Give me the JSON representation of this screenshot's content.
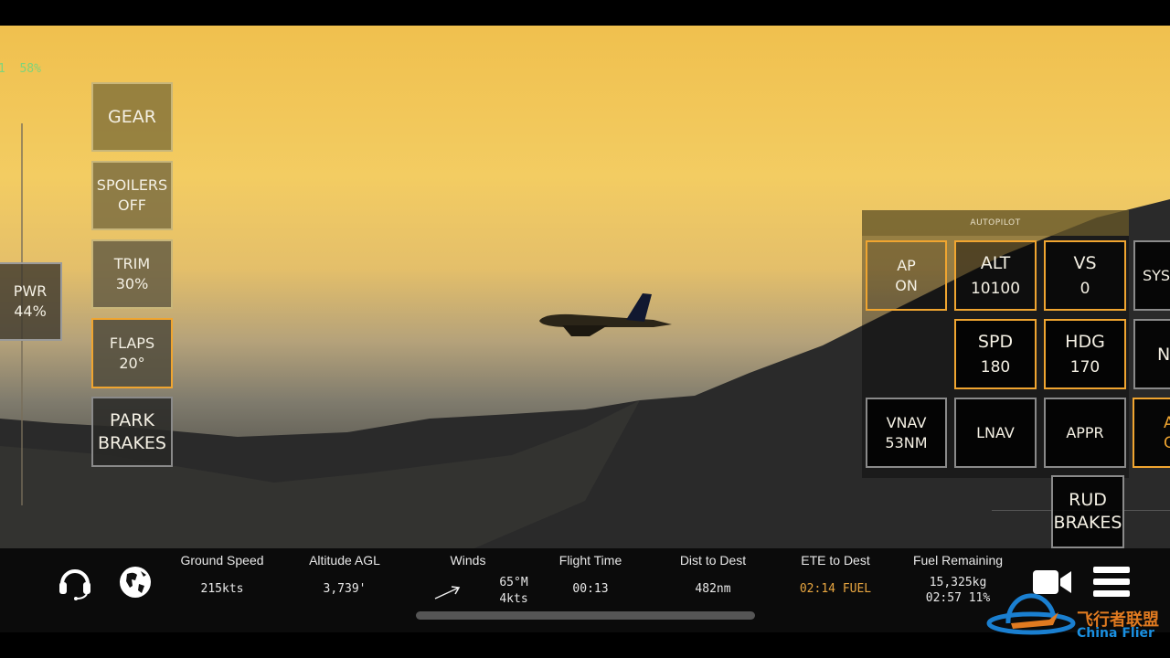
{
  "hud": {
    "top_left_readout": "1  58%"
  },
  "left_controls": [
    {
      "label": "GEAR",
      "value": ""
    },
    {
      "label": "SPOILERS",
      "value": "OFF"
    },
    {
      "label": "TRIM",
      "value": "30%"
    },
    {
      "label": "FLAPS",
      "value": "20°"
    },
    {
      "label": "PARK",
      "value": "BRAKES"
    }
  ],
  "power": {
    "label": "PWR",
    "value": "44%"
  },
  "autopilot": {
    "title": "AUTOPILOT",
    "ap": {
      "label": "AP",
      "value": "ON"
    },
    "alt": {
      "label": "ALT",
      "value": "10100"
    },
    "vs": {
      "label": "VS",
      "value": "0"
    },
    "spd": {
      "label": "SPD",
      "value": "180"
    },
    "hdg": {
      "label": "HDG",
      "value": "170"
    },
    "vnav": {
      "label": "VNAV",
      "value": "53NM"
    },
    "lnav": {
      "label": "LNAV"
    },
    "appr": {
      "label": "APPR"
    },
    "syst": {
      "label": "SYST"
    },
    "na": {
      "label": "N"
    },
    "a_partial": {
      "label": "A",
      "value": "O"
    },
    "rud": {
      "label": "RUD",
      "value": "BRAKES"
    }
  },
  "stats": {
    "ground_speed": {
      "label": "Ground Speed",
      "value": "215kts"
    },
    "altitude": {
      "label": "Altitude AGL",
      "value": "3,739'"
    },
    "winds": {
      "label": "Winds",
      "direction": "65°M",
      "speed": "4kts"
    },
    "flight_time": {
      "label": "Flight Time",
      "value": "00:13"
    },
    "dist": {
      "label": "Dist to Dest",
      "value": "482nm"
    },
    "ete": {
      "label": "ETE to Dest",
      "value": "02:14 FUEL"
    },
    "fuel": {
      "label": "Fuel Remaining",
      "mass": "15,325kg",
      "time_pct": "02:57 11%"
    }
  },
  "watermark": {
    "cn": "飞行者联盟",
    "en": "China Flier"
  },
  "colors": {
    "accent": "#f0a530",
    "ete": "#e8a640",
    "hud_green": "#7fd47a"
  }
}
